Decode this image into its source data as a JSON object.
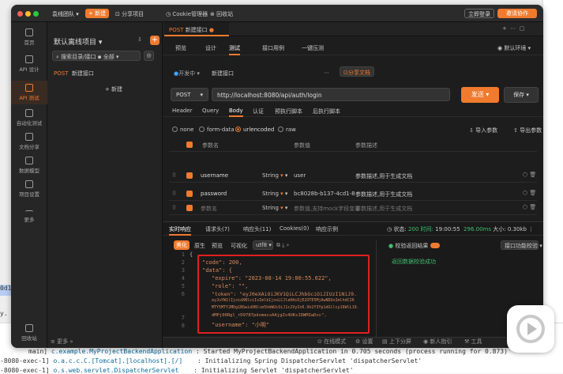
{
  "window": {
    "team": "袁线团队",
    "new_label": "+ 新建",
    "share_label": "分享项目",
    "cookie_label": "Cookie管理器",
    "trash_label": "回收站",
    "login_label": "立即登录",
    "invite_label": "邀请协作"
  },
  "sidebar": {
    "items": [
      {
        "label": "首页"
      },
      {
        "label": "API 设计"
      },
      {
        "label": "API 测试"
      },
      {
        "label": "自动化测试"
      },
      {
        "label": "文档分享"
      },
      {
        "label": "数据模型"
      },
      {
        "label": "项目设置"
      },
      {
        "label": "更多"
      }
    ],
    "trash": "回收站"
  },
  "tree": {
    "project": "默认离线项目",
    "search_placeholder": "搜索目录/接口",
    "filter": "全部",
    "items": [
      {
        "method": "POST",
        "name": "新建接口"
      }
    ],
    "new_btn": "+ 新建"
  },
  "tab": {
    "method": "POST",
    "name": "新建接口"
  },
  "subtabs": [
    "预览",
    "设计",
    "测试",
    "接口用例",
    "一键压测"
  ],
  "env": "默认环境",
  "request": {
    "env": "开发中",
    "name": "新建接口",
    "share": "分享文档",
    "method": "POST",
    "url": "http://localhost:8080/api/auth/login",
    "send": "发送",
    "save": "保存"
  },
  "reqtabs": [
    "Header",
    "Query",
    "Body",
    "认证",
    "预执行脚本",
    "后执行脚本"
  ],
  "body_types": [
    {
      "label": "none",
      "on": false
    },
    {
      "label": "form-data",
      "on": false
    },
    {
      "label": "urlencoded",
      "on": true
    },
    {
      "label": "raw",
      "on": false
    }
  ],
  "body_actions": {
    "import": "导入参数",
    "export": "导出参数"
  },
  "params": {
    "headers": [
      "参数名",
      "参数值",
      "参数描述"
    ],
    "rows": [
      {
        "name": "username",
        "type": "String",
        "value": "user",
        "desc": "参数描述,用于生成文档"
      },
      {
        "name": "password",
        "type": "String",
        "value": "bc8028b-b137-4cd1-8",
        "desc": "参数描述,用于生成文档"
      },
      {
        "name": "参数名",
        "type": "String",
        "value": "参数值,支持mock字段变量",
        "desc": "参数描述,用于生成文档"
      }
    ]
  },
  "response": {
    "tabs": [
      "实时响应",
      "请求头(7)",
      "响应头(11)",
      "Cookies(0)",
      "响应示例"
    ],
    "status_label": "状态:",
    "status": "200 时间:",
    "time": "19:00:55",
    "duration": "296.00ms",
    "size_label": "大小:",
    "size": "0.30kb",
    "views": [
      "美化",
      "原生",
      "预览",
      "可视化"
    ],
    "encoding": "utf8",
    "assert_label": "校验返回结果",
    "assert_btn": "接口功能校验",
    "assert_result": "返回数据校验成功"
  },
  "code_lines": [
    "{",
    "\"code\": 200,",
    "\"data\": {",
    "\"expire\": \"2023-08-14 19:00:55.022\",",
    "\"role\": \"\",",
    "\"token\": \"eyJ0eXAiOiJKV1QiLCJhbGciOiJIUzI1NiJ9.",
    "eyJuYW1lIjoidXNlciIsImlkIjoxLCJleHAiOjE2OTE5MjAwNDUsImlhdCI6",
    "MTY5MTY2MDg1NSwidXNlcm5hbWUiOiJ1c2VyIn0.9h2Y3Yp1dGllcy16WlL19.",
    "dMPj00Rgl_rD9787pdxmecxAAjgZs4UKsJDWMIwDcc\",",
    "\"username\": \"小明\""
  ],
  "footer": {
    "more": "更多",
    "items": [
      "在线模式",
      "设置",
      "上下分屏",
      "新人指引",
      "工具"
    ]
  },
  "terminal": [
    {
      "thread": "main]",
      "cls": "c.example.MyProjectBackendApplication",
      "msg": ": Started MyProjectBackendApplication in 0.705 seconds (process running for 0.873)"
    },
    {
      "thread": "-8080-exec-1]",
      "cls": "o.a.c.c.C.[Tomcat].[localhost].[/]",
      "msg": ": Initializing Spring DispatcherServlet 'dispatcherServlet'"
    },
    {
      "thread": "-8080-exec-1]",
      "cls": "o.s.web.servlet.DispatcherServlet",
      "msg": ": Initializing Servlet 'dispatcherServlet'"
    }
  ],
  "gutter": {
    "left1": "0d1",
    "left2": "y. Y"
  },
  "colors": {
    "accent": "#f07a2e",
    "highlight": "#e02020"
  }
}
